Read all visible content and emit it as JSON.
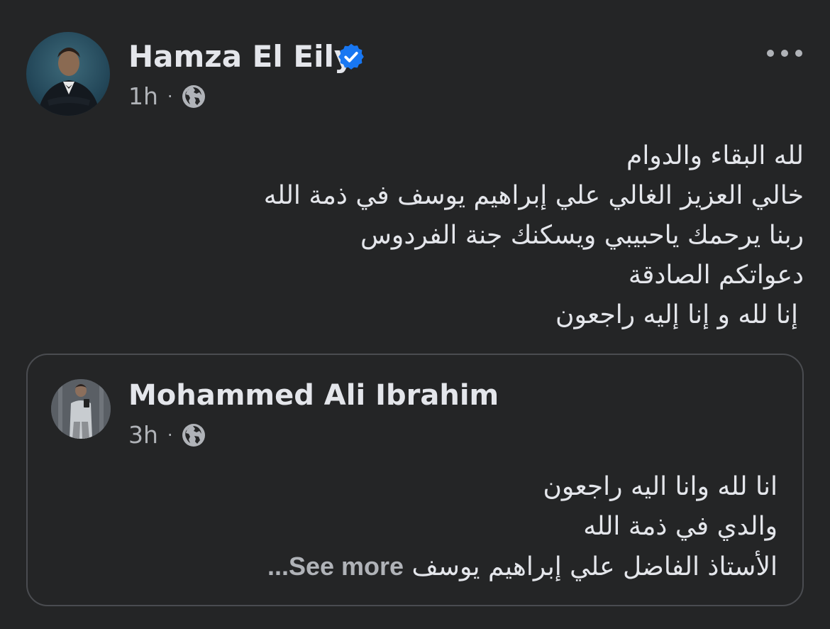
{
  "post": {
    "author": "Hamza El Eily",
    "time": "1h",
    "separator": "·",
    "privacy_icon": "globe-icon",
    "verified_icon": "verified-badge-icon",
    "more_icon": "more-options-icon",
    "lines": [
      "لله البقاء والدوام",
      "خالي العزيز الغالي علي إبراهيم يوسف في ذمة الله",
      "ربنا يرحمك ياحبيبي ويسكنك جنة الفردوس",
      "دعواتكم الصادقة",
      "إنا لله و إنا إليه راجعون"
    ]
  },
  "shared": {
    "author": "Mohammed Ali Ibrahim",
    "time": "3h",
    "separator": "·",
    "privacy_icon": "globe-icon",
    "lines": [
      "انا لله وانا اليه راجعون",
      "والدي في ذمة الله"
    ],
    "last_line": "الأستاذ الفاضل علي إبراهيم يوسف",
    "see_more": "...See more"
  },
  "colors": {
    "background": "#242526",
    "primary_text": "#e4e6eb",
    "secondary_text": "#b0b3b8",
    "verified_blue": "#1877f2",
    "card_border": "#4a4c50"
  }
}
